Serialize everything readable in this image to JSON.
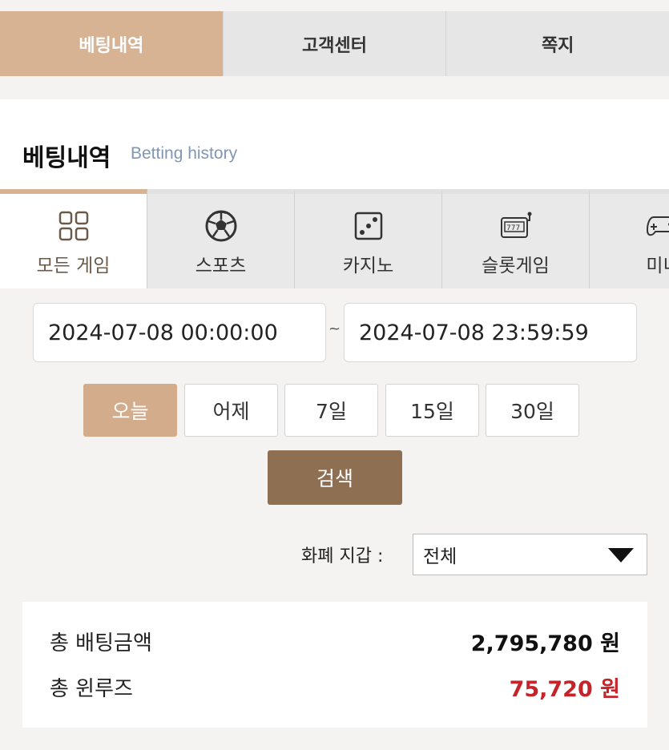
{
  "top_tabs": [
    {
      "label": "베팅내역",
      "active": true
    },
    {
      "label": "고객센터",
      "active": false
    },
    {
      "label": "쪽지",
      "active": false
    }
  ],
  "header": {
    "title": "베팅내역",
    "subtitle": "Betting history"
  },
  "game_tabs": [
    {
      "label": "모든 게임",
      "icon": "grid-icon",
      "active": true
    },
    {
      "label": "스포츠",
      "icon": "soccer-ball-icon",
      "active": false
    },
    {
      "label": "카지노",
      "icon": "dice-icon",
      "active": false
    },
    {
      "label": "슬롯게임",
      "icon": "slot-machine-icon",
      "active": false
    },
    {
      "label": "미니",
      "icon": "gamepad-icon",
      "active": false
    }
  ],
  "date_range": {
    "start": "2024-07-08 00:00:00",
    "separator": "~",
    "end": "2024-07-08 23:59:59"
  },
  "quick_ranges": [
    {
      "label": "오늘",
      "active": true
    },
    {
      "label": "어제",
      "active": false
    },
    {
      "label": "7일",
      "active": false
    },
    {
      "label": "15일",
      "active": false
    },
    {
      "label": "30일",
      "active": false
    }
  ],
  "search_label": "검색",
  "currency": {
    "label": "화폐 지갑 :",
    "selected": "전체"
  },
  "summary": {
    "total_bet_label": "총 배팅금액",
    "total_bet_value": "2,795,780 원",
    "total_winloss_label": "총 윈루즈",
    "total_winloss_value": "75,720 원"
  },
  "colors": {
    "accent": "#d7b394",
    "search_button": "#8f6f52",
    "negative": "#c4252a"
  }
}
